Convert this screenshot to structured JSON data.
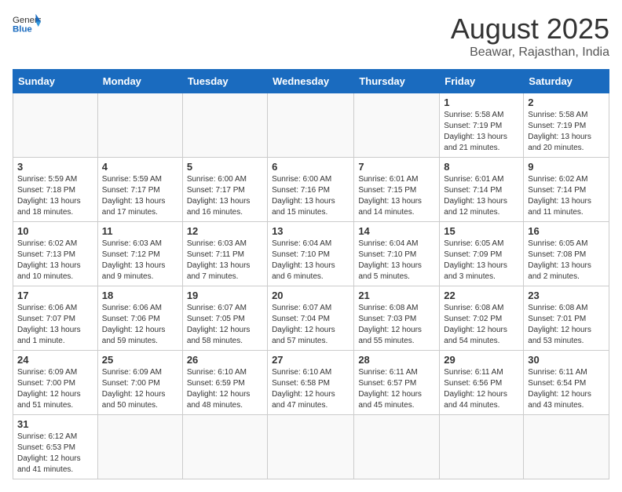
{
  "header": {
    "logo_general": "General",
    "logo_blue": "Blue",
    "title": "August 2025",
    "subtitle": "Beawar, Rajasthan, India"
  },
  "weekdays": [
    "Sunday",
    "Monday",
    "Tuesday",
    "Wednesday",
    "Thursday",
    "Friday",
    "Saturday"
  ],
  "weeks": [
    [
      {
        "day": "",
        "info": ""
      },
      {
        "day": "",
        "info": ""
      },
      {
        "day": "",
        "info": ""
      },
      {
        "day": "",
        "info": ""
      },
      {
        "day": "",
        "info": ""
      },
      {
        "day": "1",
        "info": "Sunrise: 5:58 AM\nSunset: 7:19 PM\nDaylight: 13 hours\nand 21 minutes."
      },
      {
        "day": "2",
        "info": "Sunrise: 5:58 AM\nSunset: 7:19 PM\nDaylight: 13 hours\nand 20 minutes."
      }
    ],
    [
      {
        "day": "3",
        "info": "Sunrise: 5:59 AM\nSunset: 7:18 PM\nDaylight: 13 hours\nand 18 minutes."
      },
      {
        "day": "4",
        "info": "Sunrise: 5:59 AM\nSunset: 7:17 PM\nDaylight: 13 hours\nand 17 minutes."
      },
      {
        "day": "5",
        "info": "Sunrise: 6:00 AM\nSunset: 7:17 PM\nDaylight: 13 hours\nand 16 minutes."
      },
      {
        "day": "6",
        "info": "Sunrise: 6:00 AM\nSunset: 7:16 PM\nDaylight: 13 hours\nand 15 minutes."
      },
      {
        "day": "7",
        "info": "Sunrise: 6:01 AM\nSunset: 7:15 PM\nDaylight: 13 hours\nand 14 minutes."
      },
      {
        "day": "8",
        "info": "Sunrise: 6:01 AM\nSunset: 7:14 PM\nDaylight: 13 hours\nand 12 minutes."
      },
      {
        "day": "9",
        "info": "Sunrise: 6:02 AM\nSunset: 7:14 PM\nDaylight: 13 hours\nand 11 minutes."
      }
    ],
    [
      {
        "day": "10",
        "info": "Sunrise: 6:02 AM\nSunset: 7:13 PM\nDaylight: 13 hours\nand 10 minutes."
      },
      {
        "day": "11",
        "info": "Sunrise: 6:03 AM\nSunset: 7:12 PM\nDaylight: 13 hours\nand 9 minutes."
      },
      {
        "day": "12",
        "info": "Sunrise: 6:03 AM\nSunset: 7:11 PM\nDaylight: 13 hours\nand 7 minutes."
      },
      {
        "day": "13",
        "info": "Sunrise: 6:04 AM\nSunset: 7:10 PM\nDaylight: 13 hours\nand 6 minutes."
      },
      {
        "day": "14",
        "info": "Sunrise: 6:04 AM\nSunset: 7:10 PM\nDaylight: 13 hours\nand 5 minutes."
      },
      {
        "day": "15",
        "info": "Sunrise: 6:05 AM\nSunset: 7:09 PM\nDaylight: 13 hours\nand 3 minutes."
      },
      {
        "day": "16",
        "info": "Sunrise: 6:05 AM\nSunset: 7:08 PM\nDaylight: 13 hours\nand 2 minutes."
      }
    ],
    [
      {
        "day": "17",
        "info": "Sunrise: 6:06 AM\nSunset: 7:07 PM\nDaylight: 13 hours\nand 1 minute."
      },
      {
        "day": "18",
        "info": "Sunrise: 6:06 AM\nSunset: 7:06 PM\nDaylight: 12 hours\nand 59 minutes."
      },
      {
        "day": "19",
        "info": "Sunrise: 6:07 AM\nSunset: 7:05 PM\nDaylight: 12 hours\nand 58 minutes."
      },
      {
        "day": "20",
        "info": "Sunrise: 6:07 AM\nSunset: 7:04 PM\nDaylight: 12 hours\nand 57 minutes."
      },
      {
        "day": "21",
        "info": "Sunrise: 6:08 AM\nSunset: 7:03 PM\nDaylight: 12 hours\nand 55 minutes."
      },
      {
        "day": "22",
        "info": "Sunrise: 6:08 AM\nSunset: 7:02 PM\nDaylight: 12 hours\nand 54 minutes."
      },
      {
        "day": "23",
        "info": "Sunrise: 6:08 AM\nSunset: 7:01 PM\nDaylight: 12 hours\nand 53 minutes."
      }
    ],
    [
      {
        "day": "24",
        "info": "Sunrise: 6:09 AM\nSunset: 7:00 PM\nDaylight: 12 hours\nand 51 minutes."
      },
      {
        "day": "25",
        "info": "Sunrise: 6:09 AM\nSunset: 7:00 PM\nDaylight: 12 hours\nand 50 minutes."
      },
      {
        "day": "26",
        "info": "Sunrise: 6:10 AM\nSunset: 6:59 PM\nDaylight: 12 hours\nand 48 minutes."
      },
      {
        "day": "27",
        "info": "Sunrise: 6:10 AM\nSunset: 6:58 PM\nDaylight: 12 hours\nand 47 minutes."
      },
      {
        "day": "28",
        "info": "Sunrise: 6:11 AM\nSunset: 6:57 PM\nDaylight: 12 hours\nand 45 minutes."
      },
      {
        "day": "29",
        "info": "Sunrise: 6:11 AM\nSunset: 6:56 PM\nDaylight: 12 hours\nand 44 minutes."
      },
      {
        "day": "30",
        "info": "Sunrise: 6:11 AM\nSunset: 6:54 PM\nDaylight: 12 hours\nand 43 minutes."
      }
    ],
    [
      {
        "day": "31",
        "info": "Sunrise: 6:12 AM\nSunset: 6:53 PM\nDaylight: 12 hours\nand 41 minutes."
      },
      {
        "day": "",
        "info": ""
      },
      {
        "day": "",
        "info": ""
      },
      {
        "day": "",
        "info": ""
      },
      {
        "day": "",
        "info": ""
      },
      {
        "day": "",
        "info": ""
      },
      {
        "day": "",
        "info": ""
      }
    ]
  ]
}
